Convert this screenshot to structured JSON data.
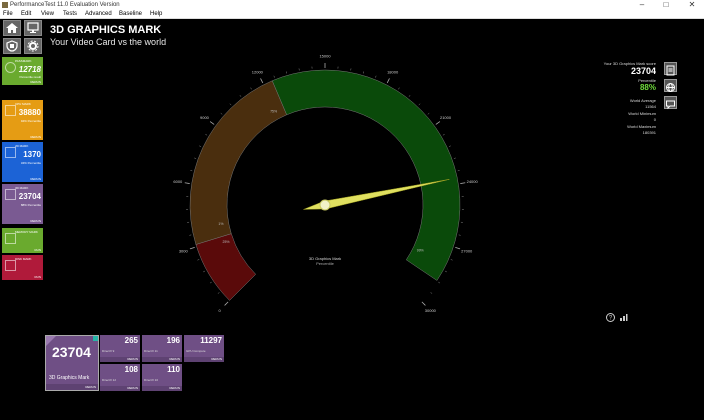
{
  "window": {
    "title": "PerformanceTest 11.0 Evaluation Version",
    "minimize": "–",
    "maximize": "□",
    "close": "✕"
  },
  "menu": [
    "File",
    "Edit",
    "View",
    "Tests",
    "Advanced",
    "Baseline",
    "Help"
  ],
  "header": {
    "title": "3D GRAPHICS MARK",
    "subtitle": "Your Video Card vs the world"
  },
  "sidebar": {
    "tiles": [
      {
        "label": "PASSMARK",
        "value": "12718",
        "desc": "Percentile result",
        "rerun": "RERUN",
        "color": "#6aaa2e"
      },
      {
        "label": "CPU MARK",
        "value": "38880",
        "desc": "94% Percentile",
        "rerun": "RERUN",
        "color": "#e59c14"
      },
      {
        "label": "2D MARK",
        "value": "1370",
        "desc": "34% Percentile",
        "rerun": "RERUN",
        "color": "#1c63d6"
      },
      {
        "label": "3D MARK",
        "value": "23704",
        "desc": "88% Percentile",
        "rerun": "RERUN",
        "color": "#7a5a92"
      },
      {
        "label": "MEMORY MARK",
        "value": "",
        "desc": "",
        "rerun": "RUN",
        "color": "#6aaa2e"
      },
      {
        "label": "DISK MARK",
        "value": "",
        "desc": "",
        "rerun": "RUN",
        "color": "#b01a3a"
      }
    ]
  },
  "gauge": {
    "value": 23704,
    "min": 0,
    "max": 30000,
    "percentile": 88,
    "tick_labels": [
      "0",
      "3000",
      "6000",
      "9000",
      "12000",
      "15000",
      "18000",
      "21000",
      "24000",
      "27000",
      "30000"
    ],
    "percent_labels": [
      "1%",
      "25%",
      "75%",
      "99%"
    ],
    "center_label": "3D Graphics Mark",
    "center_sublabel": "Percentile",
    "colors": {
      "low": "#5a0a0a",
      "mid": "#4a2e0e",
      "high": "#0a4a0a",
      "needle": "#e0e060"
    }
  },
  "stats": {
    "score_label": "Your 3D Graphics Mark score",
    "score": "23704",
    "percentile_label": "Percentile",
    "percentile": "88%",
    "avg_label": "World Average",
    "avg": "11564",
    "min_label": "World Minimum",
    "min": "0",
    "max_label": "World Maximum",
    "max": "180391"
  },
  "results": {
    "main_value": "23704",
    "main_label": "3D Graphics Mark",
    "main_rerun": "RERUN",
    "subtests": [
      {
        "value": "265",
        "label": "DirectX 9",
        "rerun": "RERUN"
      },
      {
        "value": "196",
        "label": "DirectX 11",
        "rerun": "RERUN"
      },
      {
        "value": "11297",
        "label": "GPU Compute",
        "rerun": "RERUN"
      },
      {
        "value": "108",
        "label": "DirectX 12",
        "rerun": "RERUN"
      },
      {
        "value": "110",
        "label": "DirectX 10",
        "rerun": "RERUN"
      }
    ]
  },
  "footer_icons": {
    "help": "?",
    "chart": "chart-icon"
  }
}
